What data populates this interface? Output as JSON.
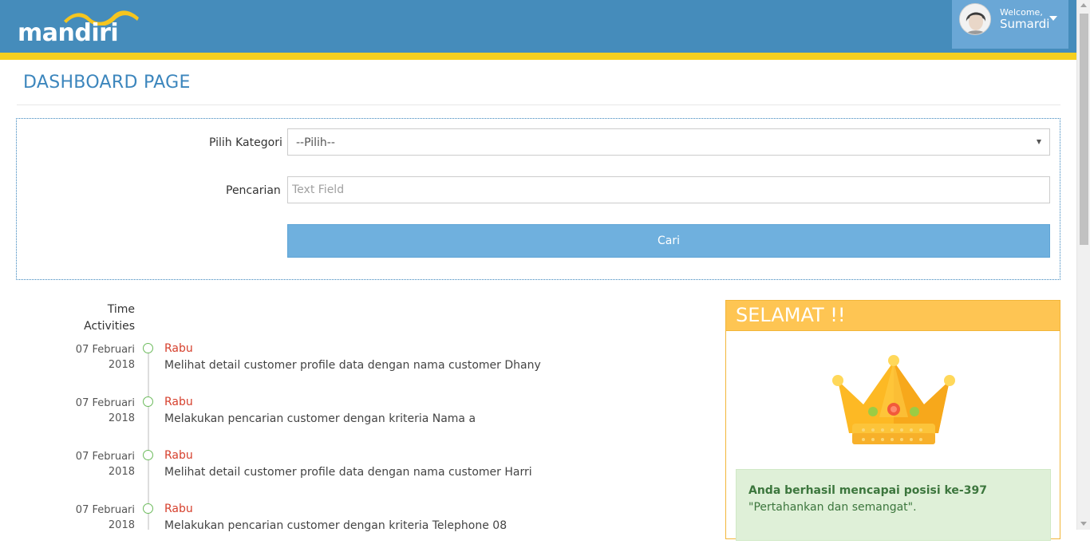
{
  "header": {
    "logo_text": "mandiri",
    "welcome_label": "Welcome,",
    "username": "Sumardi",
    "colors": {
      "bar": "#458cbb",
      "strip": "#f5cf1f",
      "user_box": "#6aa7d6"
    }
  },
  "page": {
    "title": "DASHBOARD PAGE"
  },
  "filter": {
    "kategori_label": "Pilih Kategori",
    "kategori_selected": "--Pilih--",
    "pencarian_label": "Pencarian",
    "pencarian_placeholder": "Text Field",
    "pencarian_value": "",
    "button_label": "Cari"
  },
  "timeline": {
    "header_line1": "Time",
    "header_line2": "Activities",
    "items": [
      {
        "date_line1": "07 Februari",
        "date_line2": "2018",
        "day": "Rabu",
        "text": "Melihat detail customer profile data dengan nama customer Dhany"
      },
      {
        "date_line1": "07 Februari",
        "date_line2": "2018",
        "day": "Rabu",
        "text": "Melakukan pencarian customer dengan kriteria Nama a"
      },
      {
        "date_line1": "07 Februari",
        "date_line2": "2018",
        "day": "Rabu",
        "text": "Melihat detail customer profile data dengan nama customer Harri"
      },
      {
        "date_line1": "07 Februari",
        "date_line2": "2018",
        "day": "Rabu",
        "text": "Melakukan pencarian customer dengan kriteria Telephone 08"
      }
    ]
  },
  "achievement": {
    "title": "SELAMAT !!",
    "icon": "crown-icon",
    "message_bold": "Anda berhasil mencapai posisi ke-397",
    "message_quote": "\"Pertahankan dan semangat\"."
  }
}
